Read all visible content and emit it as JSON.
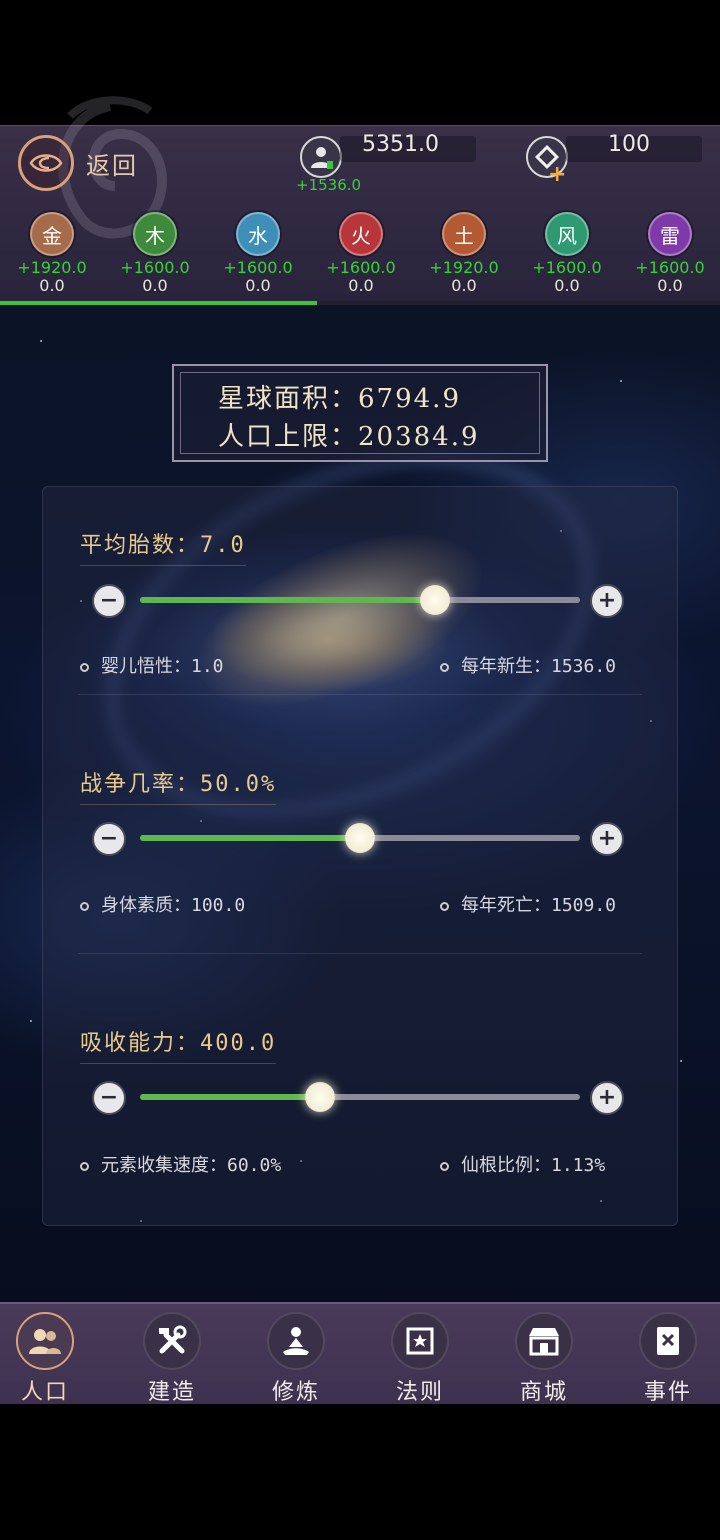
{
  "header": {
    "back_label": "返回",
    "population_value": "5351.0",
    "population_change": "+1536.0",
    "currency_value": "100"
  },
  "elements": [
    {
      "name": "金",
      "gain": "+1920.0",
      "total": "0.0",
      "color": "#a56b4a"
    },
    {
      "name": "木",
      "gain": "+1600.0",
      "total": "0.0",
      "color": "#3e8a3c"
    },
    {
      "name": "水",
      "gain": "+1600.0",
      "total": "0.0",
      "color": "#3d8fb8"
    },
    {
      "name": "火",
      "gain": "+1600.0",
      "total": "0.0",
      "color": "#b8363a"
    },
    {
      "name": "土",
      "gain": "+1920.0",
      "total": "0.0",
      "color": "#b35a34"
    },
    {
      "name": "风",
      "gain": "+1600.0",
      "total": "0.0",
      "color": "#2f9a72"
    },
    {
      "name": "雷",
      "gain": "+1600.0",
      "total": "0.0",
      "color": "#7e3aa8"
    }
  ],
  "element_progress": 0.44,
  "planet": {
    "area_label": "星球面积：",
    "area_value": "6794.9",
    "cap_label": "人口上限：",
    "cap_value": "20384.9"
  },
  "stats": [
    {
      "title": "平均胎数：7.0",
      "slider_fraction": 0.67,
      "left_info": "婴儿悟性：1.0",
      "right_info": "每年新生：1536.0"
    },
    {
      "title": "战争几率：50.0%",
      "slider_fraction": 0.5,
      "left_info": "身体素质：100.0",
      "right_info": "每年死亡：1509.0"
    },
    {
      "title": "吸收能力：400.0",
      "slider_fraction": 0.41,
      "left_info": "元素收集速度：60.0%",
      "right_info": "仙根比例：1.13%"
    }
  ],
  "nav": [
    {
      "label": "人口",
      "icon": "people-icon",
      "active": true
    },
    {
      "label": "建造",
      "icon": "tools-icon",
      "active": false
    },
    {
      "label": "修炼",
      "icon": "meditation-icon",
      "active": false
    },
    {
      "label": "法则",
      "icon": "law-icon",
      "active": false
    },
    {
      "label": "商城",
      "icon": "shop-icon",
      "active": false
    },
    {
      "label": "事件",
      "icon": "event-book-icon",
      "active": false
    }
  ]
}
